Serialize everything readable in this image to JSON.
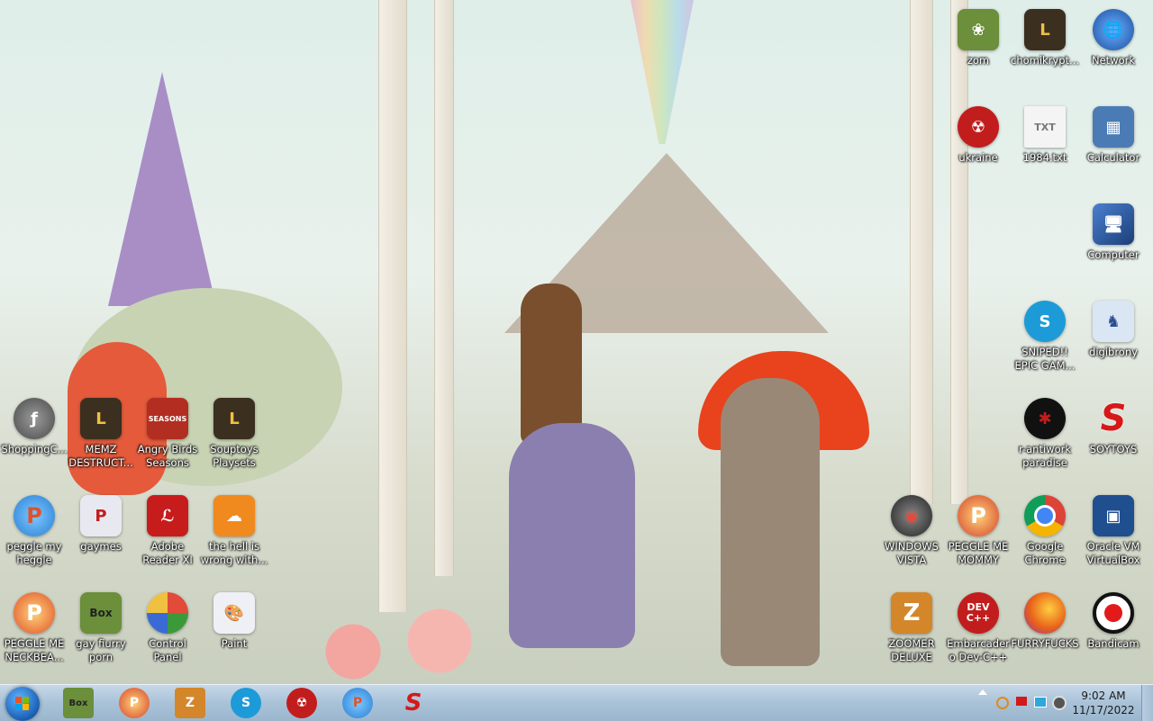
{
  "desktop_icons": [
    {
      "label": "zom",
      "icon": "zom-icon",
      "color": "#6b8f3a"
    },
    {
      "label": "chomikrypt...",
      "icon": "chomikrypt-icon",
      "color": "#3b2f20"
    },
    {
      "label": "Network",
      "icon": "network-icon",
      "color": "#2a66c9"
    },
    {
      "label": "ukraine",
      "icon": "radiation-icon",
      "color": "#c21d1d"
    },
    {
      "label": "1984.txt",
      "icon": "text-file-icon",
      "color": "#e8e8e8"
    },
    {
      "label": "Calculator",
      "icon": "calculator-icon",
      "color": "#4a7bb5"
    },
    {
      "label": "Computer",
      "icon": "computer-icon",
      "color": "#2a4f8f"
    },
    {
      "label": "SNIPED!! EPIC GAM...",
      "icon": "skype-icon",
      "color": "#1d9bd8"
    },
    {
      "label": "digibrony",
      "icon": "digibrony-icon",
      "color": "#5b8dd6"
    },
    {
      "label": "ShoppingC...",
      "icon": "flash-icon",
      "color": "#8a8a8a"
    },
    {
      "label": "MEMZ DESTRUCT...",
      "icon": "memz-icon",
      "color": "#3b2f20"
    },
    {
      "label": "Angry Birds Seasons",
      "icon": "angry-birds-icon",
      "color": "#b22e20"
    },
    {
      "label": "Souptoys Playsets",
      "icon": "souptoys-icon",
      "color": "#3b2f20"
    },
    {
      "label": "r-antiwork paradise",
      "icon": "antiwork-icon",
      "color": "#111111"
    },
    {
      "label": "SOYTOYS",
      "icon": "soytoys-icon",
      "color": "#d61818"
    },
    {
      "label": "peggle my heggle",
      "icon": "peggle-icon",
      "color": "#2a7fd4"
    },
    {
      "label": "gaymes",
      "icon": "gaymes-icon",
      "color": "#c21d1d"
    },
    {
      "label": "Adobe Reader XI",
      "icon": "adobe-reader-icon",
      "color": "#c71c1c"
    },
    {
      "label": "the hell is wrong with...",
      "icon": "uc-browser-icon",
      "color": "#f08a1e"
    },
    {
      "label": "WINDOWS VISTA",
      "icon": "vista-icon",
      "color": "#333333"
    },
    {
      "label": "PEGGLE ME MOMMY",
      "icon": "peggle-icon",
      "color": "#d4442a"
    },
    {
      "label": "Google Chrome",
      "icon": "chrome-icon",
      "color": "#2f8f3f"
    },
    {
      "label": "Oracle VM VirtualBox",
      "icon": "virtualbox-icon",
      "color": "#1f4f8f"
    },
    {
      "label": "PEGGLE ME NECKBEA...",
      "icon": "peggle-icon",
      "color": "#e0522a"
    },
    {
      "label": "gay fiurry porn",
      "icon": "box-icon",
      "color": "#6b8f3a"
    },
    {
      "label": "Control Panel",
      "icon": "control-panel-icon",
      "color": "#4a6f4a"
    },
    {
      "label": "Paint",
      "icon": "paint-icon",
      "color": "#e8e8f0"
    },
    {
      "label": "ZOOMER DELUXE",
      "icon": "zoomer-icon",
      "color": "#d4862a"
    },
    {
      "label": "Embarcadero Dev-C++",
      "icon": "devcpp-icon",
      "color": "#c21d1d"
    },
    {
      "label": "FURRYFUCKS",
      "icon": "firefox-icon",
      "color": "#e8621a"
    },
    {
      "label": "Bandicam",
      "icon": "bandicam-icon",
      "color": "#111111"
    }
  ],
  "icon_glyphs": {
    "devcpp": "DEV C++",
    "box": "Box",
    "seasons": "SEASONS"
  },
  "taskbar": {
    "pinned": [
      {
        "name": "box-app-icon",
        "glyph": "Box",
        "color": "#6b8f3a"
      },
      {
        "name": "peggle-app-icon",
        "glyph": "P",
        "color": "#d4442a"
      },
      {
        "name": "zoomer-app-icon",
        "glyph": "Z",
        "color": "#d4862a"
      },
      {
        "name": "skype-app-icon",
        "glyph": "S",
        "color": "#1d9bd8"
      },
      {
        "name": "radiation-app-icon",
        "glyph": "☢",
        "color": "#c21d1d"
      },
      {
        "name": "peggle-app-icon-2",
        "glyph": "P",
        "color": "#2a7fd4"
      },
      {
        "name": "soytoys-app-icon",
        "glyph": "S",
        "color": "#d61818"
      }
    ],
    "clock_time": "9:02 AM",
    "clock_date": "11/17/2022"
  }
}
